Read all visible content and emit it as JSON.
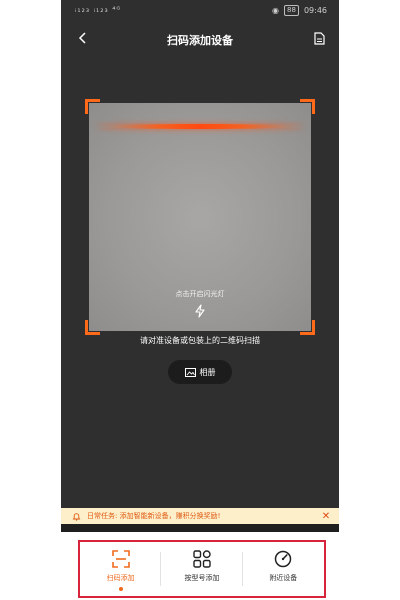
{
  "status_bar": {
    "left_text": "ᵢ₁₂₃ ᵢ₁₂₃ ⁴ᴳ",
    "time": "09:46",
    "battery": "88"
  },
  "header": {
    "title": "扫码添加设备",
    "back_icon": "chevron-left-icon",
    "doc_icon": "document-icon"
  },
  "scanner": {
    "flash_text": "点击开启闪光灯",
    "hint": "请对准设备或包装上的二维码扫描",
    "scanline_color": "#ff4a10",
    "corner_color": "#ff6a1a"
  },
  "album_button": {
    "label": "相册"
  },
  "task_banner": {
    "text": "日常任务: 添加智能新设备，赚积分换奖励!",
    "text_color": "#e05a14",
    "background": "#fdefc9"
  },
  "tabs": [
    {
      "label": "扫码添加",
      "icon": "scan-icon",
      "active": true
    },
    {
      "label": "按型号添加",
      "icon": "grid-icon",
      "active": false
    },
    {
      "label": "附近设备",
      "icon": "gauge-icon",
      "active": false
    }
  ],
  "accent_color": "#f06a1e"
}
